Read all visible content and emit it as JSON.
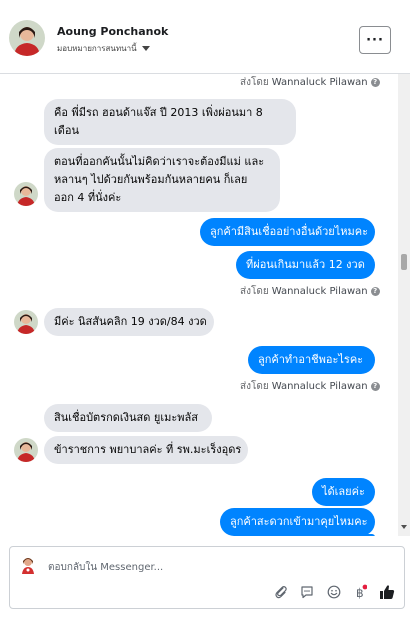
{
  "header": {
    "name": "Aoung Ponchanok",
    "subtitle": "มอบหมายการสนทนานี้",
    "more_label": "···"
  },
  "sent_by_label": "ส่งโดย",
  "sender": "Wannaluck Pilawan",
  "messages": {
    "in1": "คือ พี่มีรถ ฮอนด้าแจ๊ส ปี 2013 เพิ่งผ่อนมา 8",
    "in1b": "เดือน",
    "in2a": "ตอนที่ออกคันนั้นไม่คิดว่าเราจะต้องมีแม่ และ",
    "in2b": "หลานๆ ไปด้วยกันพร้อมกันหลายคน ก็เลย",
    "in2c": "ออก 4 ที่นั่งค่ะ",
    "out1": "ลูกค้ามีสินเชื่ออย่างอื่นด้วยไหมคะ",
    "out2": "ที่ผ่อนเกินมาแล้ว 12 งวด",
    "in3": "มีค่ะ นิสสันคลิก 19 งวด/84 งวด",
    "out3": "ลูกค้าทำอาชีพอะไรคะ",
    "in4": "สินเชื่อบัตรกดเงินสด ยูเมะพลัส",
    "in5": "ข้าราชการ พยาบาลค่ะ ที่ รพ.มะเร็งอุดร",
    "out4": "ได้เลยค่ะ",
    "out5": "ลูกค้าสะดวกเข้ามาคุยไหมคะ"
  },
  "composer": {
    "placeholder": "ตอบกลับใน Messenger..."
  },
  "icons": {
    "attach": "paperclip-icon",
    "sticker": "speech-bubble-icon",
    "emoji": "smiley-icon",
    "gif": "baht-icon",
    "like": "thumbs-up-icon"
  },
  "colors": {
    "outgoing": "#0084ff",
    "incoming": "#e4e6eb"
  }
}
